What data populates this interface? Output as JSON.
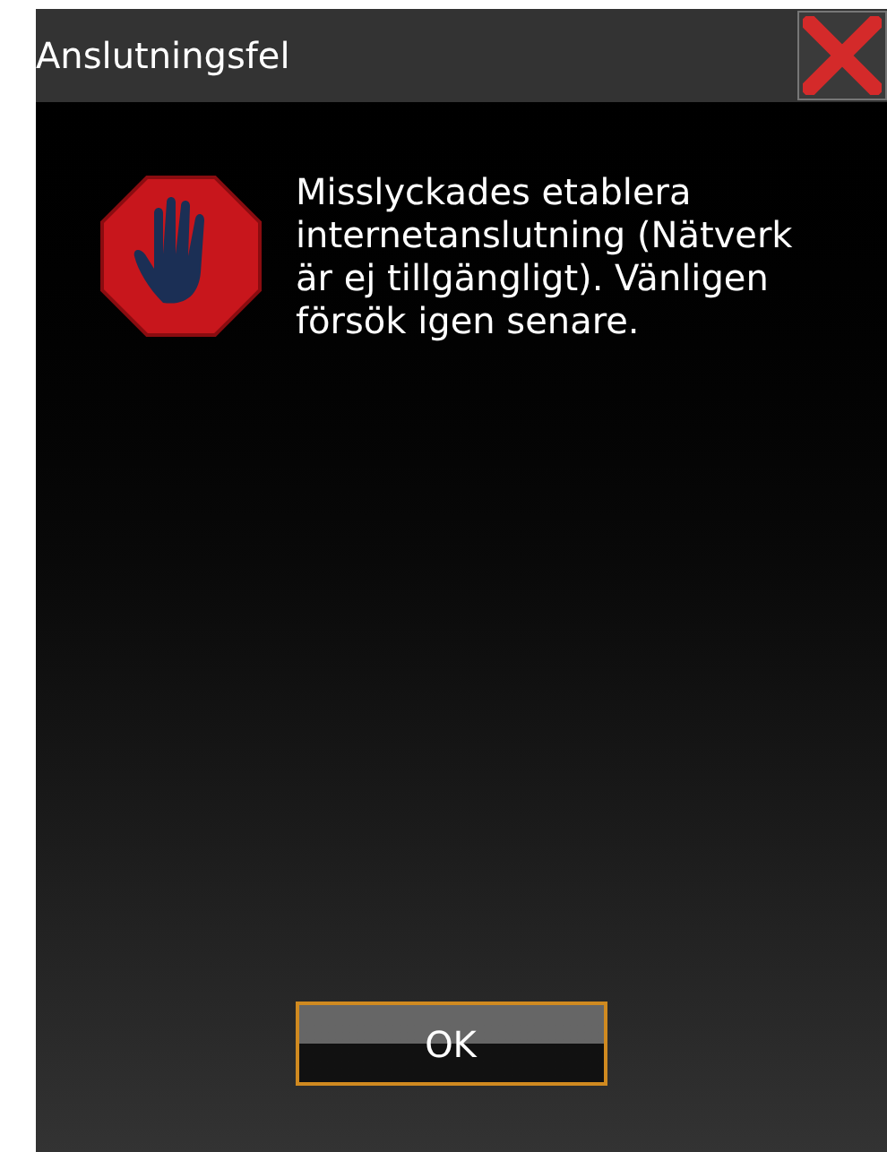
{
  "window": {
    "title": "Anslutningsfel"
  },
  "message": "Misslyckades etablera internetanslutning (Nätverk är ej tillgängligt). Vänligen försök igen senare.",
  "buttons": [
    "OK"
  ]
}
